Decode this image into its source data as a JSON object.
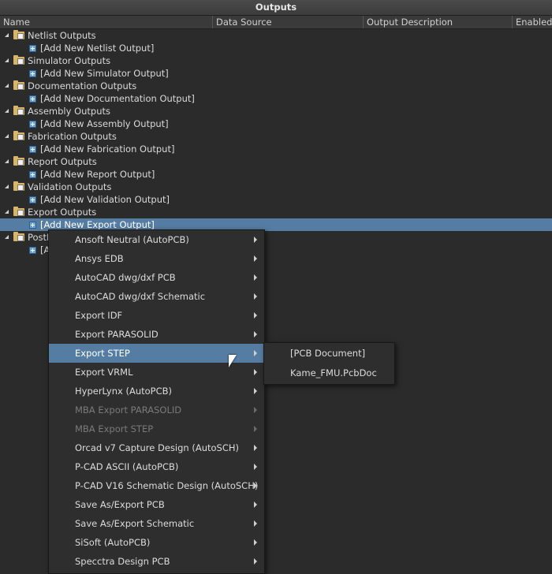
{
  "panel": {
    "title": "Outputs"
  },
  "columns": [
    "Name",
    "Data Source",
    "Output Description",
    "Enabled"
  ],
  "groups": [
    {
      "label": "Netlist Outputs",
      "add": "[Add New Netlist Output]"
    },
    {
      "label": "Simulator Outputs",
      "add": "[Add New Simulator Output]"
    },
    {
      "label": "Documentation Outputs",
      "add": "[Add New Documentation Output]"
    },
    {
      "label": "Assembly Outputs",
      "add": "[Add New Assembly Output]"
    },
    {
      "label": "Fabrication Outputs",
      "add": "[Add New Fabrication Output]"
    },
    {
      "label": "Report Outputs",
      "add": "[Add New Report Output]"
    },
    {
      "label": "Validation Outputs",
      "add": "[Add New Validation Output]"
    },
    {
      "label": "Export Outputs",
      "add": "[Add New Export Output]"
    },
    {
      "label": "PostP",
      "add": "[A"
    }
  ],
  "menu": {
    "items": [
      {
        "label": "Ansoft Neutral (AutoPCB)",
        "state": "normal"
      },
      {
        "label": "Ansys EDB",
        "state": "normal"
      },
      {
        "label": "AutoCAD dwg/dxf PCB",
        "state": "normal"
      },
      {
        "label": "AutoCAD dwg/dxf Schematic",
        "state": "normal"
      },
      {
        "label": "Export IDF",
        "state": "normal"
      },
      {
        "label": "Export PARASOLID",
        "state": "normal"
      },
      {
        "label": "Export STEP",
        "state": "hover"
      },
      {
        "label": "Export VRML",
        "state": "normal"
      },
      {
        "label": "HyperLynx (AutoPCB)",
        "state": "normal"
      },
      {
        "label": "MBA Export PARASOLID",
        "state": "disabled"
      },
      {
        "label": "MBA Export STEP",
        "state": "disabled"
      },
      {
        "label": "Orcad v7 Capture Design (AutoSCH)",
        "state": "normal"
      },
      {
        "label": "P-CAD ASCII (AutoPCB)",
        "state": "normal"
      },
      {
        "label": "P-CAD V16 Schematic Design (AutoSCH)",
        "state": "normal"
      },
      {
        "label": "Save As/Export PCB",
        "state": "normal"
      },
      {
        "label": "Save As/Export Schematic",
        "state": "normal"
      },
      {
        "label": "SiSoft (AutoPCB)",
        "state": "normal"
      },
      {
        "label": "Specctra Design PCB",
        "state": "normal"
      }
    ]
  },
  "submenu": {
    "items": [
      "[PCB Document]",
      "Kame_FMU.PcbDoc"
    ]
  }
}
